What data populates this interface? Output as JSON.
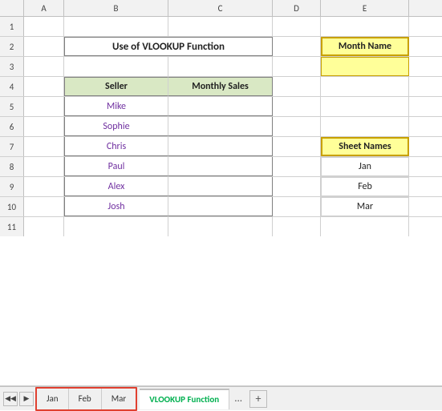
{
  "title": "Use of VLOOKUP Function",
  "columns": [
    "A",
    "B",
    "C",
    "D",
    "E"
  ],
  "rows": [
    {
      "num": 1,
      "cells": [
        "",
        "",
        "",
        "",
        ""
      ]
    },
    {
      "num": 2,
      "cells": [
        "",
        "Use of VLOOKUP Function",
        "",
        "",
        "Month Name"
      ]
    },
    {
      "num": 3,
      "cells": [
        "",
        "",
        "",
        "",
        ""
      ]
    },
    {
      "num": 4,
      "cells": [
        "",
        "Seller",
        "Monthly Sales",
        "",
        ""
      ]
    },
    {
      "num": 5,
      "cells": [
        "",
        "Mike",
        "",
        "",
        ""
      ]
    },
    {
      "num": 6,
      "cells": [
        "",
        "Sophie",
        "",
        "",
        ""
      ]
    },
    {
      "num": 7,
      "cells": [
        "",
        "Chris",
        "",
        "",
        "Sheet Names"
      ]
    },
    {
      "num": 8,
      "cells": [
        "",
        "Paul",
        "",
        "",
        "Jan"
      ]
    },
    {
      "num": 9,
      "cells": [
        "",
        "Alex",
        "",
        "",
        "Feb"
      ]
    },
    {
      "num": 10,
      "cells": [
        "",
        "Josh",
        "",
        "",
        "Mar"
      ]
    },
    {
      "num": 11,
      "cells": [
        "",
        "",
        "",
        "",
        ""
      ]
    }
  ],
  "tabs": {
    "sheets": [
      "Jan",
      "Feb",
      "Mar"
    ],
    "active": "VLOOKUP Function",
    "active_label": "VLOOKUP Function",
    "dots": "...",
    "add": "+"
  },
  "colors": {
    "accent_green": "#00b050",
    "tab_border_red": "#e04030",
    "header_bg": "#d9e8c4",
    "month_bg": "#ffff99",
    "seller_color": "#7030a0"
  }
}
